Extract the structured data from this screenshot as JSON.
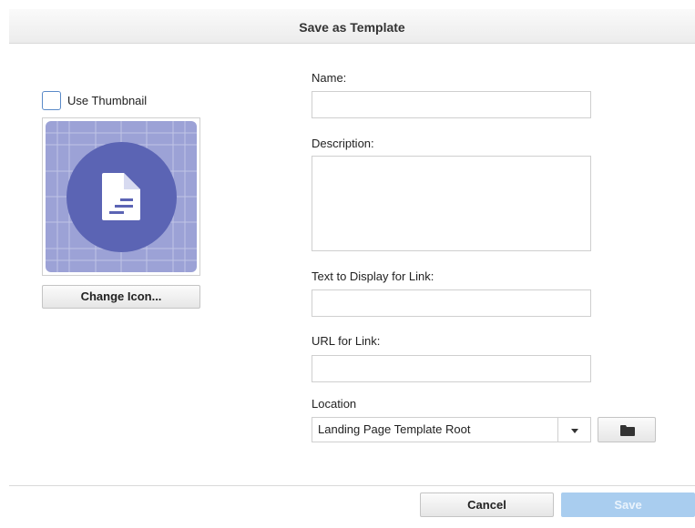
{
  "dialog": {
    "title": "Save as Template"
  },
  "thumbnail": {
    "use_thumbnail_label": "Use Thumbnail",
    "use_thumbnail_checked": false,
    "change_icon_label": "Change Icon..."
  },
  "form": {
    "name_label": "Name:",
    "name_value": "",
    "description_label": "Description:",
    "description_value": "",
    "link_text_label": "Text to Display for Link:",
    "link_text_value": "",
    "url_label": "URL for Link:",
    "url_value": "",
    "location_label": "Location",
    "location_value": "Landing Page Template Root"
  },
  "footer": {
    "cancel_label": "Cancel",
    "save_label": "Save"
  },
  "colors": {
    "tile_background": "#9ca2d6",
    "icon_circle": "#5b64b4",
    "save_disabled": "#a9cdef",
    "checkbox_border": "#5a8ac8"
  },
  "icons": [
    "document-icon",
    "chevron-down-icon",
    "folder-icon"
  ]
}
